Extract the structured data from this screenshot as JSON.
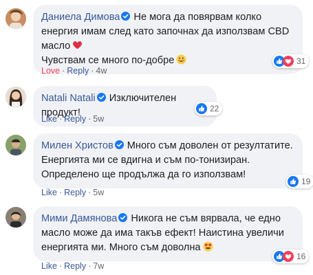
{
  "comments": [
    {
      "author": "Даниела Димова",
      "text": "Не мога да повярвам колко енергия имам след като започнах да използвам CBD масло",
      "text2": "Чувствам се много по-добре",
      "reaction_count": "31",
      "action_first": "Love",
      "action_reply": "Reply",
      "time": "4w",
      "emoji1": "red-heart-emoji",
      "emoji2": "grinning-face-emoji"
    },
    {
      "author": "Natali Natali",
      "text": "Изключителен продукт!",
      "reaction_count": "22",
      "action_first": "Like",
      "action_reply": "Reply",
      "time": "5w"
    },
    {
      "author": "Милен Христов",
      "text": "Много съм доволен от резултатите. Енергията ми се вдигна и съм по-тонизиран. Определено ще продължа да го използвам!",
      "reaction_count": "19",
      "action_first": "Like",
      "action_reply": "Reply",
      "time": "5w"
    },
    {
      "author": "Мими Дамянова",
      "text": "Никога не съм вярвала, че едно масло може да има такъв ефект! Наистина увеличи енергията ми. Много съм доволна",
      "reaction_count": "16",
      "action_first": "Like",
      "action_reply": "Reply",
      "time": "7w",
      "emoji1": "heart-eyes-emoji"
    }
  ],
  "colors": {
    "author": "#385898",
    "like": "#1877f2",
    "love": "#f33e58",
    "bubble": "#f0f2f5"
  }
}
